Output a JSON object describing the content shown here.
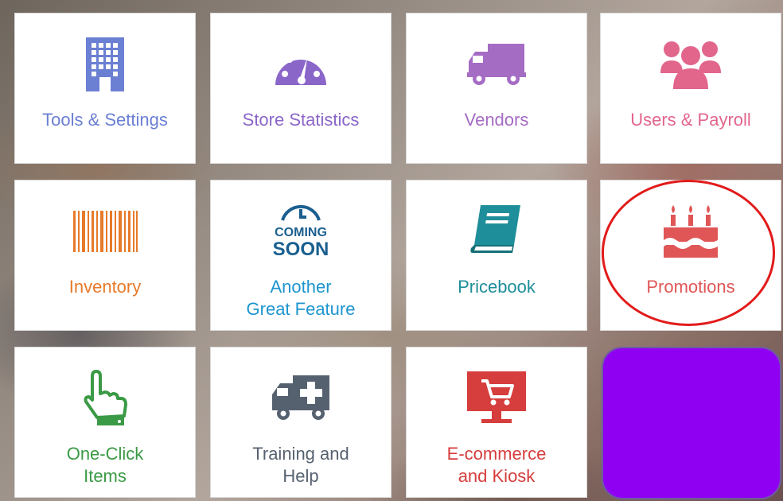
{
  "tiles": [
    {
      "label": "Tools & Settings",
      "icon": "building-icon",
      "color": "#6b7fd3"
    },
    {
      "label": "Store Statistics",
      "icon": "speedometer-icon",
      "color": "#8b66c9"
    },
    {
      "label": "Vendors",
      "icon": "truck-icon",
      "color": "#a56cc4"
    },
    {
      "label": "Users & Payroll",
      "icon": "users-group-icon",
      "color": "#e2658c"
    },
    {
      "label": "Inventory",
      "icon": "barcode-icon",
      "color": "#e77a2a"
    },
    {
      "label": "Another\nGreat Feature",
      "icon": "coming-soon-icon",
      "color": "#1d95cf",
      "badge_top": "COMING",
      "badge_bottom": "SOON"
    },
    {
      "label": "Pricebook",
      "icon": "book-icon",
      "color": "#1e8f9a"
    },
    {
      "label": "Promotions",
      "icon": "birthday-cake-icon",
      "color": "#e05656",
      "highlighted": true
    },
    {
      "label": "One-Click\nItems",
      "icon": "pointing-hand-icon",
      "color": "#3b9a45"
    },
    {
      "label": "Training and\nHelp",
      "icon": "ambulance-icon",
      "color": "#566170"
    },
    {
      "label": "E-commerce\nand Kiosk",
      "icon": "shopping-cart-monitor-icon",
      "color": "#d63d3d"
    }
  ],
  "highlight_color": "#e21b1b",
  "empty_tile_color": "#8f00f2"
}
